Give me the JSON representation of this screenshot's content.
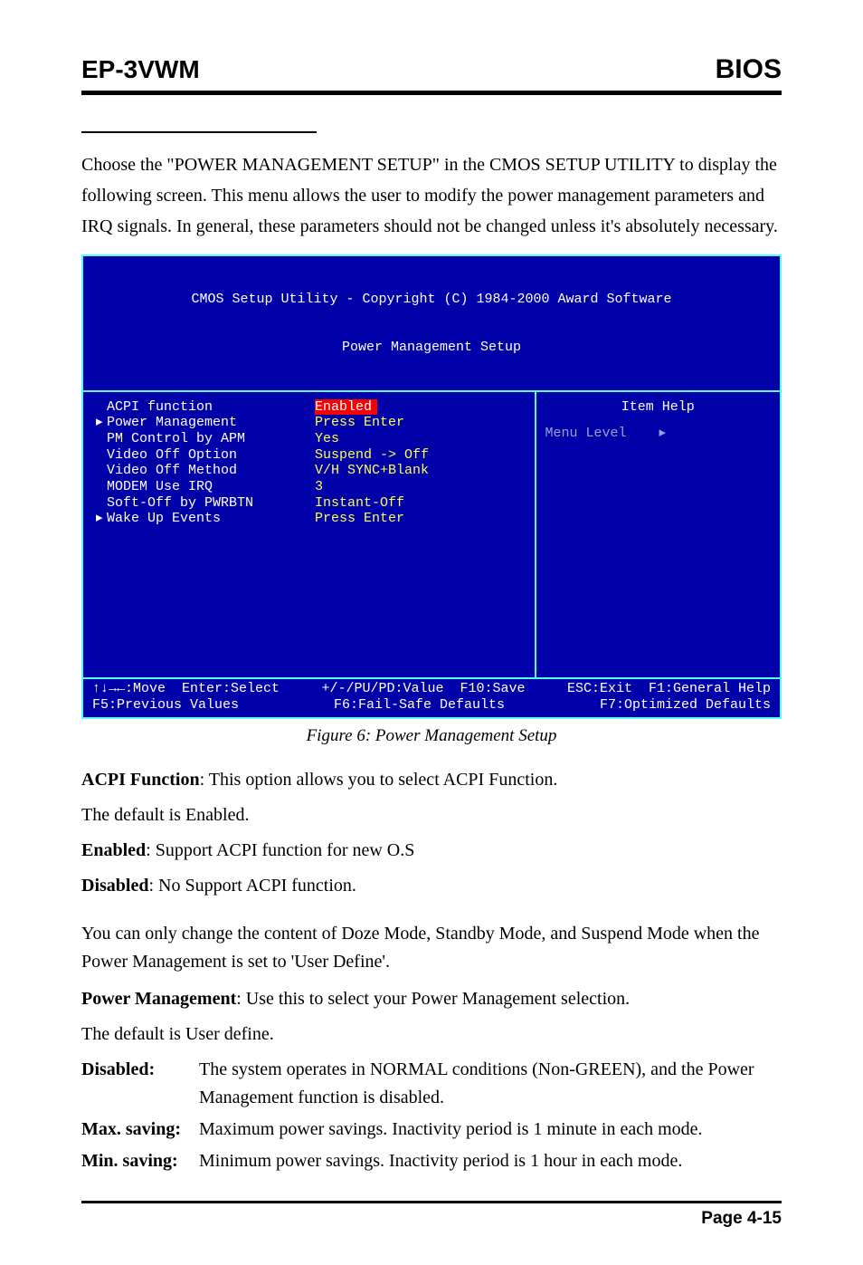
{
  "header": {
    "left": "EP-3VWM",
    "right": "BIOS"
  },
  "intro": "Choose the \"POWER MANAGEMENT SETUP\" in the CMOS SETUP UTILITY to display the following screen. This menu allows the user to modify the power management parameters and IRQ signals. In general, these parameters should not be changed unless it's absolutely necessary.",
  "bios": {
    "title1": "CMOS Setup Utility - Copyright (C) 1984-2000 Award Software",
    "title2": "Power Management Setup",
    "rows": [
      {
        "marker": " ",
        "label": "ACPI function",
        "value": "Enabled",
        "hl": true
      },
      {
        "marker": "▸",
        "label": "Power Management",
        "value": "Press Enter",
        "hl": false
      },
      {
        "marker": " ",
        "label": "PM Control by APM",
        "value": "Yes",
        "hl": false
      },
      {
        "marker": " ",
        "label": "Video Off Option",
        "value": "Suspend -> Off",
        "hl": false
      },
      {
        "marker": " ",
        "label": "Video Off Method",
        "value": "V/H SYNC+Blank",
        "hl": false
      },
      {
        "marker": " ",
        "label": "MODEM Use IRQ",
        "value": "3",
        "hl": false
      },
      {
        "marker": " ",
        "label": "Soft-Off by PWRBTN",
        "value": "Instant-Off",
        "hl": false
      },
      {
        "marker": "▸",
        "label": "Wake Up Events",
        "value": "Press Enter",
        "hl": false
      }
    ],
    "help_title": "Item Help",
    "menu_level": "Menu Level    ▸",
    "footer_l1_left": "↑↓→←:Move  Enter:Select",
    "footer_l1_mid": "+/-/PU/PD:Value  F10:Save",
    "footer_l1_right": "ESC:Exit  F1:General Help",
    "footer_l2_left": "F5:Previous Values",
    "footer_l2_mid": "F6:Fail-Safe Defaults",
    "footer_l2_right": "F7:Optimized Defaults"
  },
  "caption": "Figure 6:  Power Management Setup",
  "acpi": {
    "line1_b": "ACPI Function",
    "line1_r": ": This option allows you to select ACPI Function.",
    "line2": "The default is Enabled.",
    "en_b": "Enabled",
    "en_r": ":  Support ACPI function for new O.S",
    "dis_b": "Disabled",
    "dis_r": ": No Support ACPI function."
  },
  "note": "You can only change the content of Doze Mode, Standby Mode, and Suspend Mode when the Power Management is set to 'User Define'.",
  "pm": {
    "line1_b": "Power Management",
    "line1_r": ": Use this to select your Power Management selection.",
    "line2": "The default is User define.",
    "defs": [
      {
        "term": "Disabled:",
        "body": "The system operates in NORMAL conditions (Non-GREEN), and the Power Management function is disabled."
      },
      {
        "term": "Max. saving:",
        "body": "Maximum power savings. Inactivity period is 1 minute in each mode."
      },
      {
        "term": "Min. saving:",
        "body": "Minimum power savings. Inactivity period is 1 hour in each mode."
      }
    ]
  },
  "page_num": "Page 4-15"
}
